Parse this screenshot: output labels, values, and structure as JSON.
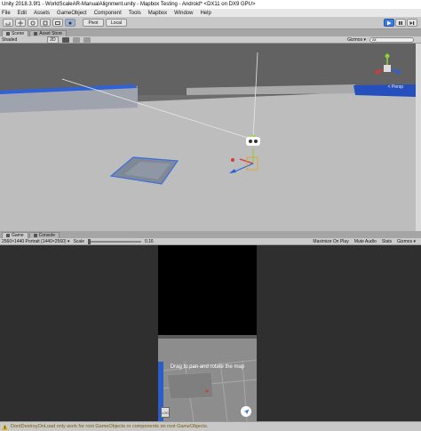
{
  "window": {
    "title": "Unity 2018.3.9f1 - WorldScaleAR-ManualAlignment.unity - Mapbox Testing - Android* <DX11 on DX9 GPU>"
  },
  "menu": [
    "File",
    "Edit",
    "Assets",
    "GameObject",
    "Component",
    "Tools",
    "Mapbox",
    "Window",
    "Help"
  ],
  "toolbar": {
    "pivot": "Pivot",
    "local": "Local"
  },
  "scene_tabs": {
    "scene": "Scene",
    "asset_store": "Asset Store"
  },
  "scene_bar": {
    "shading": "Shaded",
    "mode_2d": "2D",
    "gizmos": "Gizmos ▾",
    "search_placeholder": "All"
  },
  "gizmo": {
    "persp": "< Persp"
  },
  "game_tabs": {
    "game": "Game",
    "console": "Console"
  },
  "game_bar": {
    "resolution": "2560×1440 Portrait (1440×2560) ▾",
    "scale_label": "Scale",
    "scale_value": "0.16",
    "maximize": "Maximize On Play",
    "mute": "Mute Audio",
    "stats": "Stats",
    "gizmos": "Gizmos ▾"
  },
  "map_ui": {
    "hint": "Drag to pan and rotate the map",
    "log_label": "LOG"
  },
  "status": {
    "message": "DontDestroyOnLoad only work for root GameObjects or components on root GameObjects."
  },
  "colors": {
    "accent": "#3b7be0",
    "warning": "#e0b000",
    "selection": "#2c5cc5"
  }
}
